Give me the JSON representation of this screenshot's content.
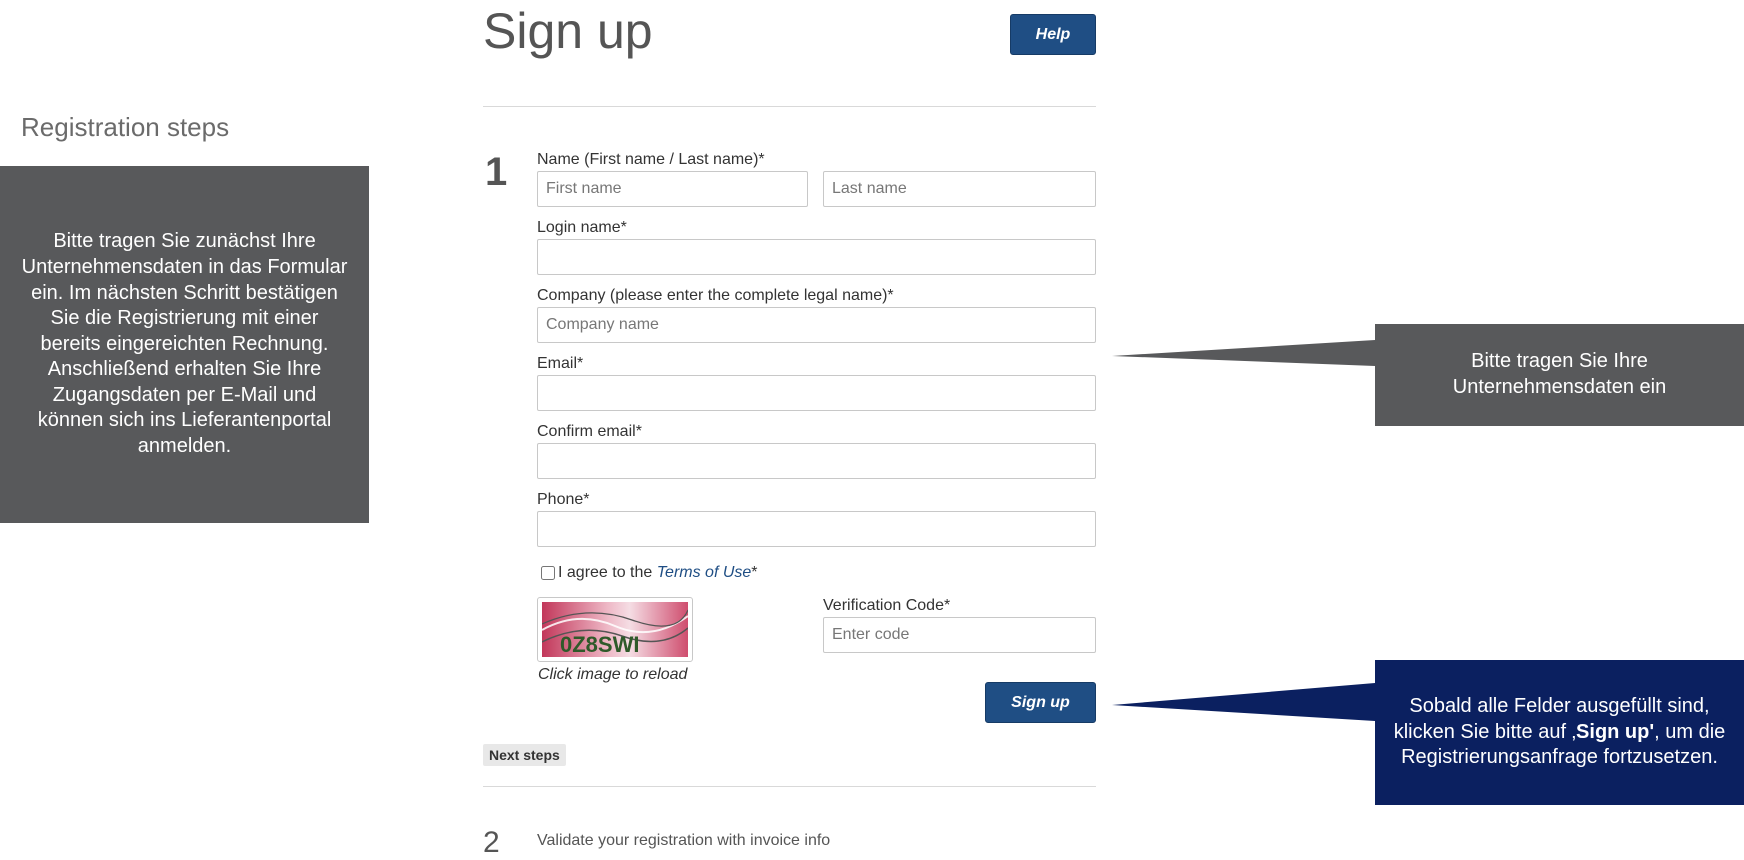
{
  "left_panel": {
    "title": "Registration steps",
    "info": "Bitte tragen Sie zunächst Ihre Unternehmensdaten in das Formular ein. Im nächsten Schritt bestätigen Sie die Registrierung mit einer bereits eingereichten Rechnung. Anschließend erhalten Sie Ihre Zugangsdaten per E-Mail und können sich ins Lieferantenportal anmelden."
  },
  "form": {
    "title": "Sign up",
    "help_label": "Help",
    "step1_number": "1",
    "name": {
      "label": "Name (First name / Last name)*",
      "first_placeholder": "First name",
      "last_placeholder": "Last name"
    },
    "login": {
      "label": "Login name*"
    },
    "company": {
      "label": "Company (please enter the complete legal name)*",
      "placeholder": "Company name"
    },
    "email": {
      "label": "Email*"
    },
    "confirm_email": {
      "label": "Confirm email*"
    },
    "phone": {
      "label": "Phone*"
    },
    "terms": {
      "prefix": "I agree to the ",
      "link": "Terms of Use",
      "suffix": "*",
      "checked": false
    },
    "captcha": {
      "text": "0Z8SWI",
      "reload_label": "Click image to reload"
    },
    "verification": {
      "label": "Verification Code*",
      "placeholder": "Enter code"
    },
    "signup_label": "Sign up",
    "next_steps_label": "Next steps",
    "step2_number": "2",
    "step2_text": "Validate your registration with invoice info"
  },
  "callouts": {
    "company_hint": "Bitte tragen Sie Ihre Unternehmensdaten ein",
    "signup_hint_prefix": "Sobald alle Felder ausgefüllt sind, klicken Sie bitte auf ‚",
    "signup_hint_bold": "Sign up'",
    "signup_hint_suffix": ", um die Registrierungsanfrage fortzusetzen."
  },
  "colors": {
    "primary_button": "#1f4e84",
    "callout_gray": "#58595b",
    "callout_navy": "#0b2060"
  }
}
